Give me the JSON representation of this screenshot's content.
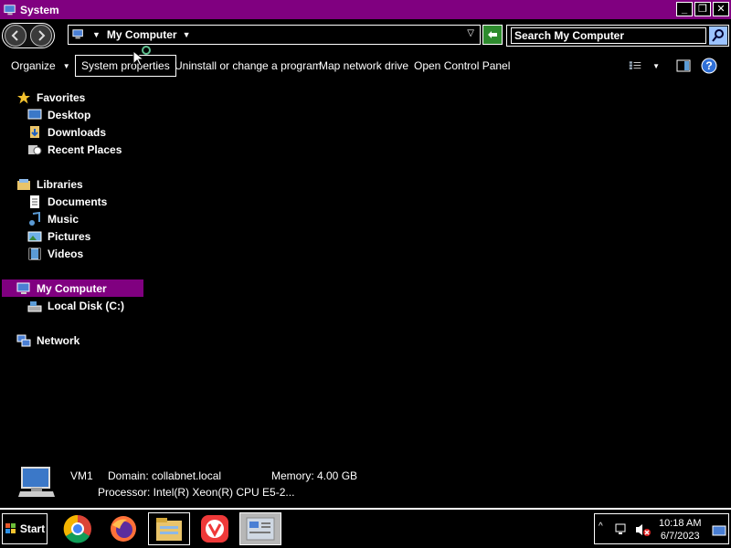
{
  "window": {
    "title": "System",
    "minimize_label": "_",
    "maximize_label": "❐",
    "close_label": "✕"
  },
  "address": {
    "crumb": "My Computer",
    "search_placeholder": "Search My Computer"
  },
  "commands": {
    "organize": "Organize",
    "system_properties": "System properties",
    "uninstall": "Uninstall or change a program",
    "map_drive": "Map network drive",
    "control_panel": "Open Control Panel"
  },
  "nav": {
    "favorites": "Favorites",
    "desktop": "Desktop",
    "downloads": "Downloads",
    "recent": "Recent Places",
    "libraries": "Libraries",
    "documents": "Documents",
    "music": "Music",
    "pictures": "Pictures",
    "videos": "Videos",
    "my_computer": "My Computer",
    "local_disk": "Local Disk (C:)",
    "network": "Network"
  },
  "details": {
    "name": "VM1",
    "domain": "Domain: collabnet.local",
    "memory": "Memory: 4.00 GB",
    "processor": "Processor: Intel(R) Xeon(R) CPU E5-2..."
  },
  "taskbar": {
    "start": "Start",
    "time": "10:18 AM",
    "date": "6/7/2023"
  },
  "colors": {
    "accent": "#800080",
    "background": "#000000",
    "text": "#ffffff"
  },
  "icons": {
    "app": "computer-icon",
    "back": "back-arrow-icon",
    "forward": "forward-arrow-icon",
    "search": "magnifier-icon",
    "views": "view-options-icon",
    "help": "help-icon"
  }
}
